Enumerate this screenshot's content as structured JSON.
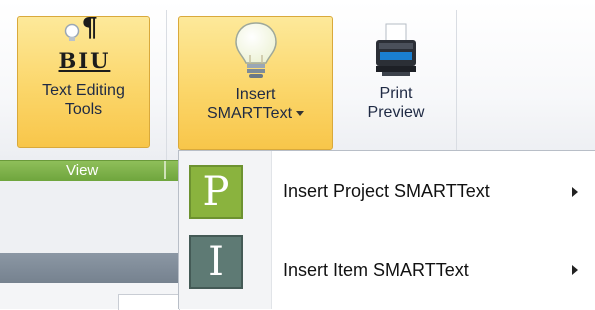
{
  "ribbon": {
    "text_editing": {
      "line1": "Text Editing",
      "line2": "Tools",
      "icon": "paragraph-format-icon",
      "glyph_top": "¶",
      "glyph_bottom": "BIU"
    },
    "insert_smarttext": {
      "line1": "Insert",
      "line2": "SMARTText",
      "icon": "lightbulb-icon"
    },
    "print_preview": {
      "line1": "Print",
      "line2": "Preview",
      "icon": "printer-icon"
    },
    "group_label": "View"
  },
  "menu": {
    "items": [
      {
        "badge": "P",
        "label": "Insert Project SMARTText",
        "badge_color": "#8ab33e"
      },
      {
        "badge": "I",
        "label": "Insert Item SMARTText",
        "badge_color": "#5e7a74"
      }
    ]
  },
  "colors": {
    "highlight": "#fbd66a",
    "view_bar": "#78ad45"
  }
}
